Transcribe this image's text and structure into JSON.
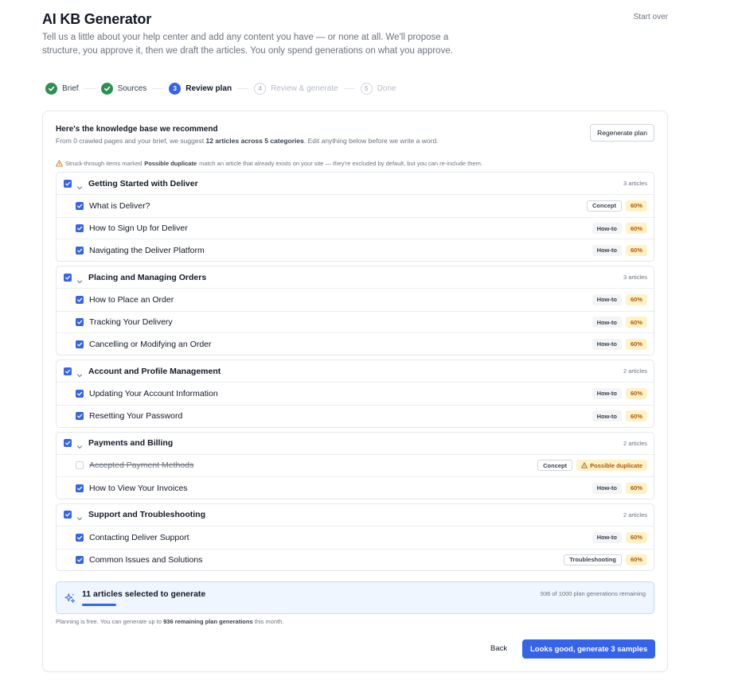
{
  "header": {
    "title": "AI KB Generator",
    "start_over": "Start over",
    "subtitle": "Tell us a little about your help center and add any content you have — or none at all. We'll propose a structure, you approve it, then we draft the articles. You only spend generations on what you approve."
  },
  "stepper": {
    "steps": [
      {
        "num": "",
        "label": "Brief",
        "state": "done"
      },
      {
        "num": "",
        "label": "Sources",
        "state": "done"
      },
      {
        "num": "3",
        "label": "Review plan",
        "state": "active"
      },
      {
        "num": "4",
        "label": "Review & generate",
        "state": "todo"
      },
      {
        "num": "5",
        "label": "Done",
        "state": "todo"
      }
    ]
  },
  "plan": {
    "title": "Here's the knowledge base we recommend",
    "desc_prefix": "From 0 crawled pages and your brief, we suggest ",
    "desc_bold": "12 articles across 5 categories",
    "desc_suffix": ". Edit anything below before we write a word.",
    "regenerate_label": "Regenerate plan",
    "notice_prefix": "Struck-through items marked ",
    "notice_bold": "Possible duplicate",
    "notice_suffix": " match an article that already exists on your site — they're excluded by default, but you can re-include them.",
    "groups": [
      {
        "name": "Getting Started with Deliver",
        "count": "3 articles",
        "checked": true,
        "articles": [
          {
            "title": "What is Deliver?",
            "type": "Concept",
            "type_style": "outline",
            "badge": "60%",
            "checked": true,
            "struck": false
          },
          {
            "title": "How to Sign Up for Deliver",
            "type": "How-to",
            "type_style": "plain",
            "badge": "60%",
            "checked": true,
            "struck": false
          },
          {
            "title": "Navigating the Deliver Platform",
            "type": "How-to",
            "type_style": "plain",
            "badge": "60%",
            "checked": true,
            "struck": false
          }
        ]
      },
      {
        "name": "Placing and Managing Orders",
        "count": "3 articles",
        "checked": true,
        "articles": [
          {
            "title": "How to Place an Order",
            "type": "How-to",
            "type_style": "plain",
            "badge": "60%",
            "checked": true,
            "struck": false
          },
          {
            "title": "Tracking Your Delivery",
            "type": "How-to",
            "type_style": "plain",
            "badge": "60%",
            "checked": true,
            "struck": false
          },
          {
            "title": "Cancelling or Modifying an Order",
            "type": "How-to",
            "type_style": "plain",
            "badge": "60%",
            "checked": true,
            "struck": false
          }
        ]
      },
      {
        "name": "Account and Profile Management",
        "count": "2 articles",
        "checked": true,
        "articles": [
          {
            "title": "Updating Your Account Information",
            "type": "How-to",
            "type_style": "plain",
            "badge": "60%",
            "checked": true,
            "struck": false
          },
          {
            "title": "Resetting Your Password",
            "type": "How-to",
            "type_style": "plain",
            "badge": "60%",
            "checked": true,
            "struck": false
          }
        ]
      },
      {
        "name": "Payments and Billing",
        "count": "2 articles",
        "checked": true,
        "articles": [
          {
            "title": "Accepted Payment Methods",
            "type": "Concept",
            "type_style": "outline",
            "badge": "Possible duplicate",
            "checked": false,
            "struck": true
          },
          {
            "title": "How to View Your Invoices",
            "type": "How-to",
            "type_style": "plain",
            "badge": "60%",
            "checked": true,
            "struck": false
          }
        ]
      },
      {
        "name": "Support and Troubleshooting",
        "count": "2 articles",
        "checked": true,
        "articles": [
          {
            "title": "Contacting Deliver Support",
            "type": "How-to",
            "type_style": "plain",
            "badge": "60%",
            "checked": true,
            "struck": false
          },
          {
            "title": "Common Issues and Solutions",
            "type": "Troubleshooting",
            "type_style": "outline",
            "badge": "60%",
            "checked": true,
            "struck": false
          }
        ]
      }
    ]
  },
  "summary": {
    "selected": "11 articles selected to generate",
    "remaining": "936 of 1000 plan generations remaining",
    "usage_fraction": 0.064
  },
  "footnote": {
    "prefix": "Planning is free. You can generate up to ",
    "bold": "936 remaining plan generations",
    "suffix": " this month."
  },
  "actions": {
    "back": "Back",
    "primary": "Looks good, generate 3 samples"
  },
  "colors": {
    "accent": "#3563e9",
    "done": "#2f8f4e",
    "warning": "#b45309",
    "warning_bg": "#fef3c7"
  }
}
